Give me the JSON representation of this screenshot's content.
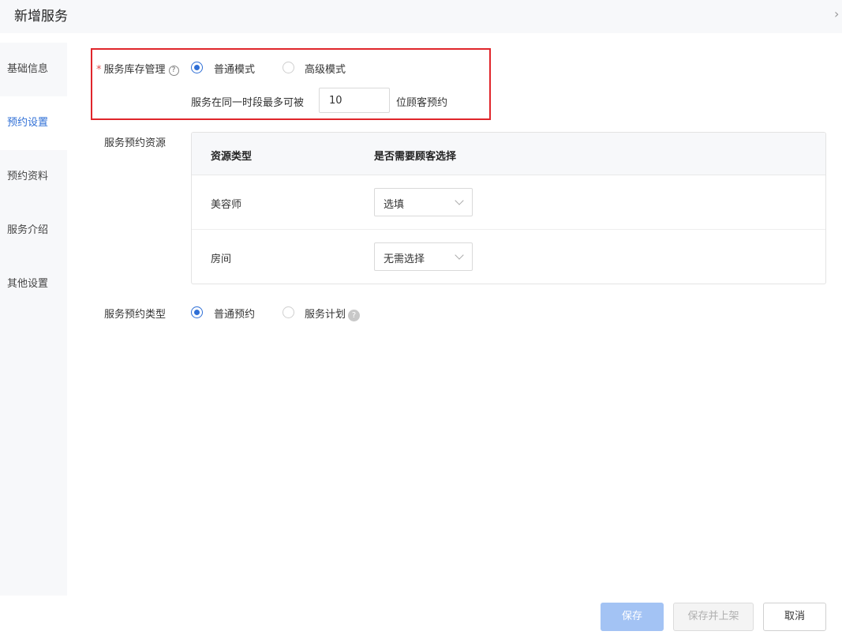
{
  "header": {
    "title": "新增服务",
    "collapse_icon": "chevron-right-icon"
  },
  "sidebar": {
    "items": [
      {
        "label": "基础信息",
        "active": false
      },
      {
        "label": "预约设置",
        "active": true
      },
      {
        "label": "预约资料",
        "active": false
      },
      {
        "label": "服务介绍",
        "active": false
      },
      {
        "label": "其他设置",
        "active": false
      }
    ]
  },
  "inventory": {
    "required_mark": "*",
    "label": "服务库存管理",
    "help_icon": "question-circle-icon",
    "options": [
      {
        "label": "普通模式",
        "selected": true
      },
      {
        "label": "高级模式",
        "selected": false
      }
    ],
    "limit_prefix": "服务在同一时段最多可被",
    "limit_value": "10",
    "limit_suffix": "位顾客预约"
  },
  "resources": {
    "label": "服务预约资源",
    "columns": [
      "资源类型",
      "是否需要顾客选择"
    ],
    "rows": [
      {
        "type": "美容师",
        "choice": "选填"
      },
      {
        "type": "房间",
        "choice": "无需选择"
      }
    ]
  },
  "booking_type": {
    "label": "服务预约类型",
    "options": [
      {
        "label": "普通预约",
        "selected": true
      },
      {
        "label": "服务计划",
        "selected": false
      }
    ],
    "help_icon": "question-filled-icon"
  },
  "footer": {
    "save": "保存",
    "save_and_list": "保存并上架",
    "cancel": "取消"
  },
  "colors": {
    "accent": "#2f6fd6",
    "highlight": "#e0262b",
    "save_disabled": "#a3c3f4"
  }
}
